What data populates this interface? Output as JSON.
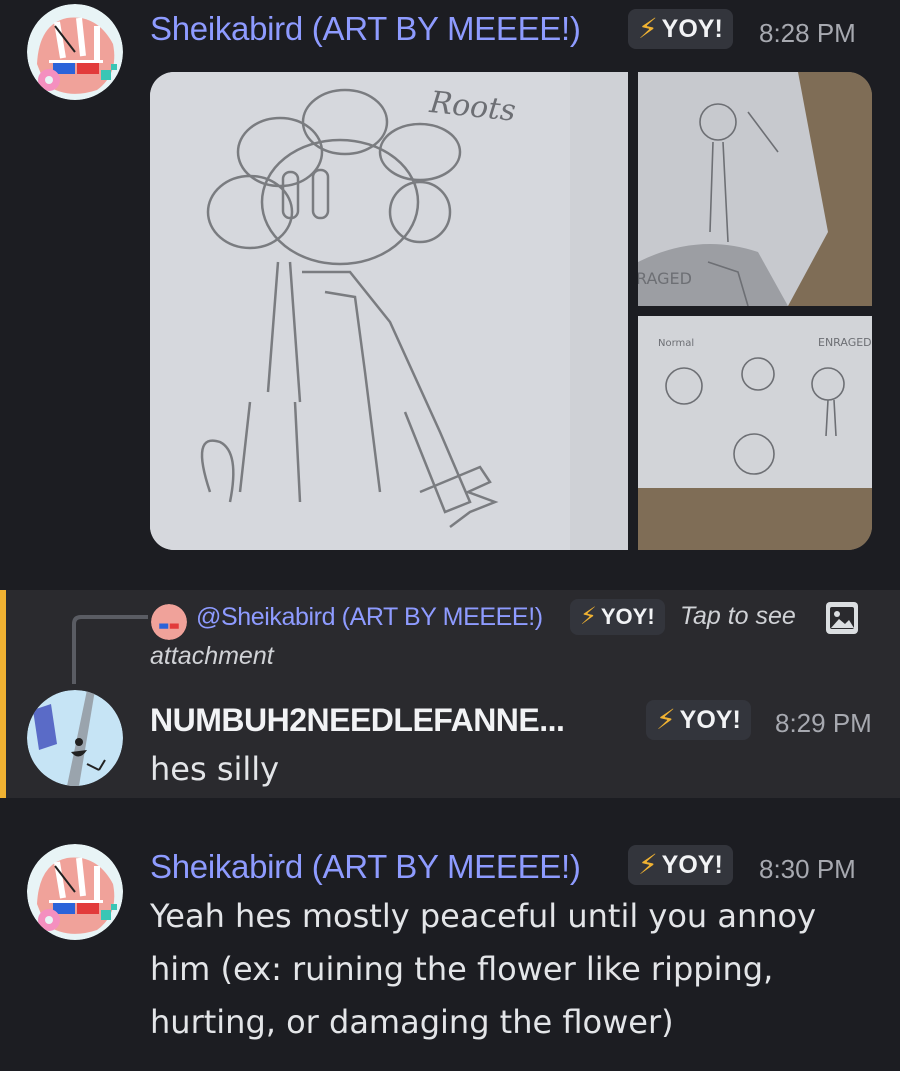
{
  "messages": [
    {
      "author": "Sheikabird (ART BY MEEEE!)",
      "badge": "YOY!",
      "time": "8:28 PM",
      "attachments": {
        "main_caption": "Roots",
        "side_top_caption": "RAGED",
        "side_bottom_labels": [
          "Normal",
          "ENRAGED"
        ]
      }
    },
    {
      "reply": {
        "mention": "@Sheikabird (ART BY MEEEE!)",
        "badge": "YOY!",
        "tap_text": "Tap to see",
        "tap_text2": "attachment"
      },
      "author": "NUMBUH2NEEDLEFANNE...",
      "badge": "YOY!",
      "time": "8:29 PM",
      "text": "hes silly"
    },
    {
      "author": "Sheikabird (ART BY MEEEE!)",
      "badge": "YOY!",
      "time": "8:30 PM",
      "text": "Yeah hes mostly peaceful until you annoy\nhim (ex: ruining the flower like ripping,\nhurting, or damaging the flower)"
    }
  ],
  "colors": {
    "background": "#1c1d22",
    "author": "#8e9bff",
    "badge_bg": "#33353c",
    "bolt": "#f0b232",
    "reply_highlight": "#2a2a2e",
    "reply_border": "#f0b232"
  },
  "icons": [
    "bolt-icon",
    "image-icon",
    "avatar-sheikabird",
    "avatar-needle"
  ]
}
